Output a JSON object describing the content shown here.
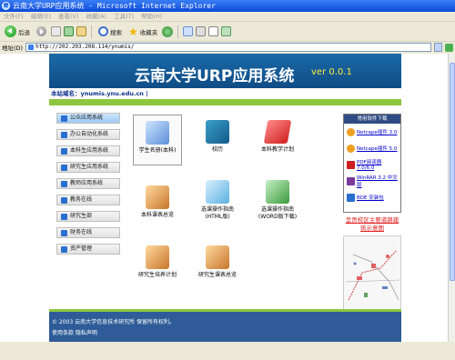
{
  "window": {
    "title": "云南大学URP应用系统 - Microsoft Internet Explorer"
  },
  "menubar": {
    "items": [
      "文件(F)",
      "编辑(E)",
      "查看(V)",
      "收藏(A)",
      "工具(T)",
      "帮助(H)"
    ]
  },
  "toolbar": {
    "back_label": "后退",
    "search_label": "搜索",
    "favorites_label": "收藏夹"
  },
  "address": {
    "label": "地址(D)",
    "url": "http://202.203.208.114/ynumis/",
    "go_label": "转到"
  },
  "banner": {
    "title": "云南大学URP应用系统",
    "version": "ver 0.0.1"
  },
  "site": {
    "domain_label": "本站域名：ynumis.ynu.edu.cn |"
  },
  "nav": {
    "items": [
      "公众应用系统",
      "办公自动化系统",
      "本科生应用系统",
      "研究生应用系统",
      "教师应用系统",
      "教务在线",
      "研究生部",
      "财务在线",
      "资产管理"
    ]
  },
  "apps": [
    {
      "label": "学生名册(本科)"
    },
    {
      "label": "校历"
    },
    {
      "label": "本科教学计划"
    },
    {
      "label": "本科课表总览"
    },
    {
      "label": "选课操作指南\n(HTML版)"
    },
    {
      "label": "选课操作指南\n(WORD版下载)"
    },
    {
      "label": "研究生培养计划"
    },
    {
      "label": "研究生课表总览"
    }
  ],
  "downloads": {
    "header": "常用软件下载",
    "items": [
      "Netcape插件 3.0",
      "Netcape插件 5.0",
      "PDF阅读器 7.0/6.0",
      "WinRAR 3.2 中文版",
      "BDE 安装包"
    ]
  },
  "map": {
    "link": "呈贡校区主要道路建筑示意图"
  },
  "footer": {
    "copyright": "© 2003 云南大学信息技术研究所 保留所有权利。",
    "note": "使用条款 隐私声明"
  },
  "colors": {
    "banner": "#1a6aa8",
    "accent_green": "#8cc63f",
    "footer": "#2f5c98"
  }
}
